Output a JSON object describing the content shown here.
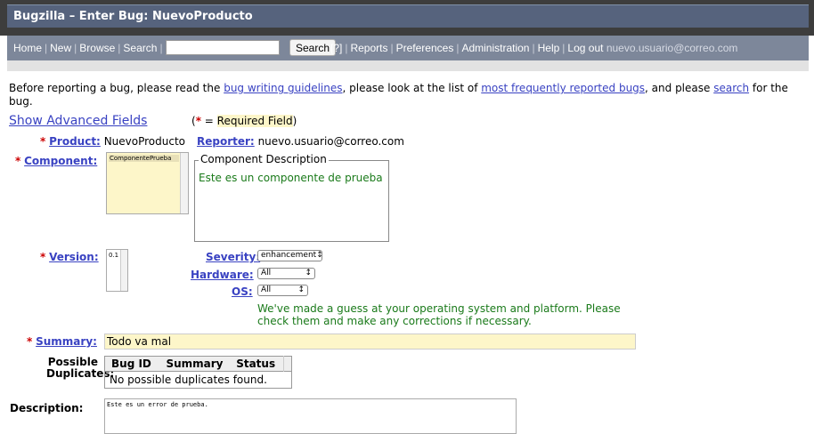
{
  "window": {
    "title": "Bugzilla – Enter Bug: NuevoProducto"
  },
  "nav": {
    "items": [
      "Home",
      "New",
      "Browse",
      "Search"
    ],
    "search_button": "Search",
    "help": "[?]",
    "items2": [
      "Reports",
      "Preferences",
      "Administration",
      "Help",
      "Log out"
    ],
    "user": "nuevo.usuario@correo.com"
  },
  "intro": {
    "t1": "Before reporting a bug, please read the ",
    "l1": "bug writing guidelines",
    "t2": ", please look at the list of ",
    "l2": "most frequently reported bugs",
    "t3": ", and please ",
    "l3": "search",
    "t4": " for the",
    "t5": "bug."
  },
  "advanced_link": "Show Advanced Fields",
  "required_note": {
    "open": "(",
    "star": "*",
    "eq": " = ",
    "text": "Required Field",
    "close": ")"
  },
  "form": {
    "product_label": "Product:",
    "product_value": "NuevoProducto",
    "reporter_label": "Reporter:",
    "reporter_value": "nuevo.usuario@correo.com",
    "component_label": "Component:",
    "component_option": "ComponentePrueba",
    "component_desc_title": "Component Description",
    "component_desc": "Este es un componente de prueba",
    "version_label": "Version:",
    "version_option": "0.1",
    "severity_label": "Severity:",
    "severity_value": "enhancement",
    "hardware_label": "Hardware:",
    "hardware_value": "All",
    "os_label": "OS:",
    "os_value": "All",
    "guess_note_1": "We've made a guess at your operating system and platform. Please",
    "guess_note_2": "check them and make any corrections if necessary.",
    "summary_label": "Summary:",
    "summary_value": "Todo va mal",
    "dup_label_1": "Possible",
    "dup_label_2": "Duplicates:",
    "dup_headers": [
      "Bug ID",
      "Summary",
      "Status"
    ],
    "dup_empty": "No possible duplicates found.",
    "description_label": "Description:",
    "description_value": "Este es un error de prueba."
  }
}
